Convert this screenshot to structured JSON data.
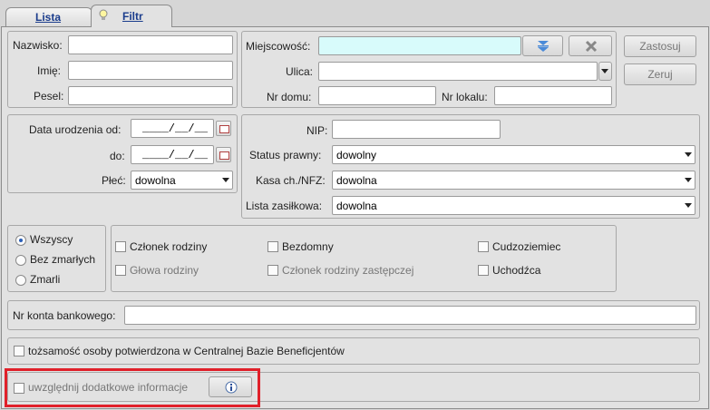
{
  "tabs": [
    {
      "label": "Lista"
    },
    {
      "label": "Filtr"
    }
  ],
  "person": {
    "nazwisko_label": "Nazwisko:",
    "imie_label": "Imię:",
    "pesel_label": "Pesel:"
  },
  "address": {
    "miejscowosc_label": "Miejscowość:",
    "ulica_label": "Ulica:",
    "nr_domu_label": "Nr domu:",
    "nr_lokalu_label": "Nr lokalu:"
  },
  "actions": {
    "zastosuj": "Zastosuj",
    "zeruj": "Zeruj"
  },
  "dates": {
    "data_od_label": "Data urodzenia od:",
    "do_label": "do:",
    "placeholder": "____/__/__",
    "plec_label": "Płeć:",
    "plec_value": "dowolna"
  },
  "status": {
    "nip_label": "NIP:",
    "status_prawny_label": "Status prawny:",
    "status_prawny_value": "dowolny",
    "kasa_label": "Kasa ch./NFZ:",
    "kasa_value": "dowolna",
    "lista_label": "Lista zasiłkowa:",
    "lista_value": "dowolna"
  },
  "radios": [
    {
      "label": "Wszyscy",
      "checked": true
    },
    {
      "label": "Bez zmarłych",
      "checked": false
    },
    {
      "label": "Zmarli",
      "checked": false
    }
  ],
  "checkboxes": {
    "czlonek_rodziny": "Członek rodziny",
    "glowa_rodziny": "Głowa rodziny",
    "bezdomny": "Bezdomny",
    "czlonek_zastepczej": "Członek rodziny zastępczej",
    "cudzoziemiec": "Cudzoziemiec",
    "uchodzca": "Uchodźca"
  },
  "bank": {
    "label": "Nr konta bankowego:"
  },
  "identity": {
    "label": "tożsamość osoby potwierdzona w Centralnej Bazie Beneficjentów"
  },
  "extra": {
    "label": "uwzględnij dodatkowe informacje"
  },
  "colors": {
    "highlight_border": "#e0202a",
    "miejscowosc_bg": "#d8fbfb",
    "tab_text": "#1a3c8c"
  }
}
